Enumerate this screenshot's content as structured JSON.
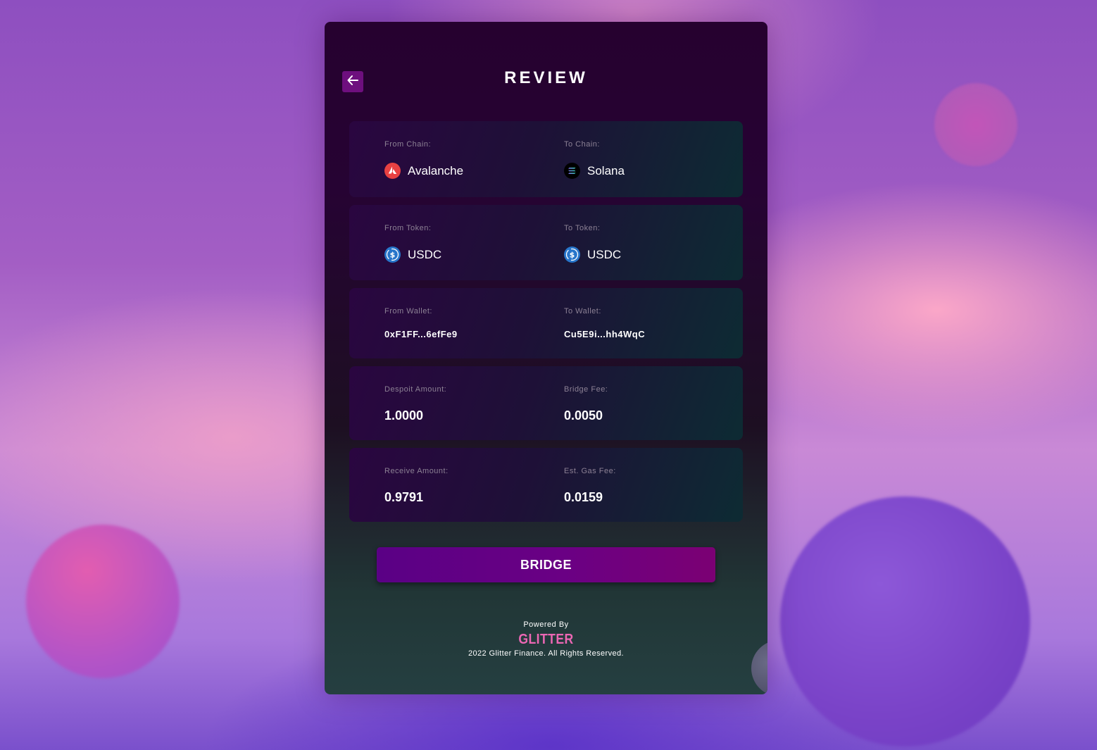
{
  "review": {
    "title": "REVIEW"
  },
  "cards": {
    "chain": {
      "from_label": "From Chain:",
      "from_value": "Avalanche",
      "from_icon": "avalanche-icon",
      "to_label": "To Chain:",
      "to_value": "Solana",
      "to_icon": "solana-icon"
    },
    "token": {
      "from_label": "From Token:",
      "from_value": "USDC",
      "from_icon": "usdc-icon",
      "to_label": "To Token:",
      "to_value": "USDC",
      "to_icon": "usdc-icon"
    },
    "wallet": {
      "from_label": "From Wallet:",
      "from_value": "0xF1FF...6efFe9",
      "to_label": "To Wallet:",
      "to_value": "Cu5E9i...hh4WqC"
    },
    "deposit": {
      "from_label": "Despoit Amount:",
      "from_value": "1.0000",
      "to_label": "Bridge Fee:",
      "to_value": "0.0050"
    },
    "receive": {
      "from_label": "Receive Amount:",
      "from_value": "0.9791",
      "to_label": "Est. Gas Fee:",
      "to_value": "0.0159"
    }
  },
  "actions": {
    "bridge_label": "BRIDGE",
    "back_icon": "arrow-left-icon"
  },
  "footer": {
    "powered_by": "Powered By",
    "brand": "GLITTER",
    "copyright": "2022 Glitter Finance. All Rights Reserved."
  },
  "colors": {
    "accent": "#6e0f7e",
    "brand": "#ec67b4",
    "avalanche": "#e84142",
    "usdc": "#2775ca"
  }
}
